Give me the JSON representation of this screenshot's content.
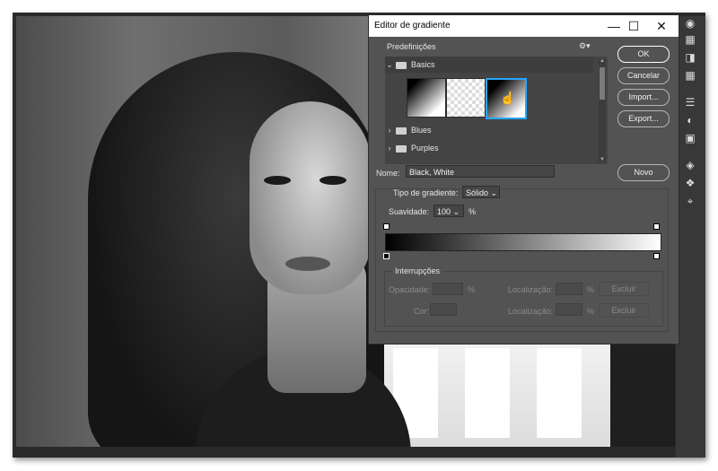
{
  "dialog": {
    "title": "Editor de gradiente",
    "window_controls": {
      "minimize": "—",
      "maximize": "☐",
      "close": "✕"
    },
    "presets": {
      "label": "Predefinições",
      "folders": [
        {
          "label": "Basics",
          "expanded": true
        },
        {
          "label": "Blues",
          "expanded": false
        },
        {
          "label": "Purples",
          "expanded": false
        }
      ],
      "swatches": [
        "black-to-white",
        "transparent",
        "black-white-selected"
      ]
    },
    "buttons": {
      "ok": "OK",
      "cancel": "Cancelar",
      "import": "Import...",
      "export": "Export..."
    },
    "name": {
      "label": "Nome:",
      "value": "Black, White",
      "new_button": "Novo"
    },
    "gradient_type": {
      "label": "Tipo de gradiente:",
      "value": "Sólido"
    },
    "smoothness": {
      "label": "Suavidade:",
      "value": "100",
      "unit": "%"
    },
    "stops": {
      "label": "Interrupções",
      "opacity_label": "Opacidade:",
      "opacity_unit": "%",
      "location_label": "Localização:",
      "location_unit": "%",
      "delete_label": "Excluir",
      "color_label": "Cor:"
    },
    "colors": {
      "gradient_start": "#000000",
      "gradient_end": "#ffffff",
      "selection": "#28a6ff"
    }
  },
  "toolbar": {
    "icons": [
      "3d-icon",
      "table-icon",
      "swatches-icon",
      "grid-icon",
      "adjust-icon",
      "color-icon",
      "properties-icon",
      "layers-icon",
      "channels-icon",
      "paths-icon"
    ]
  }
}
